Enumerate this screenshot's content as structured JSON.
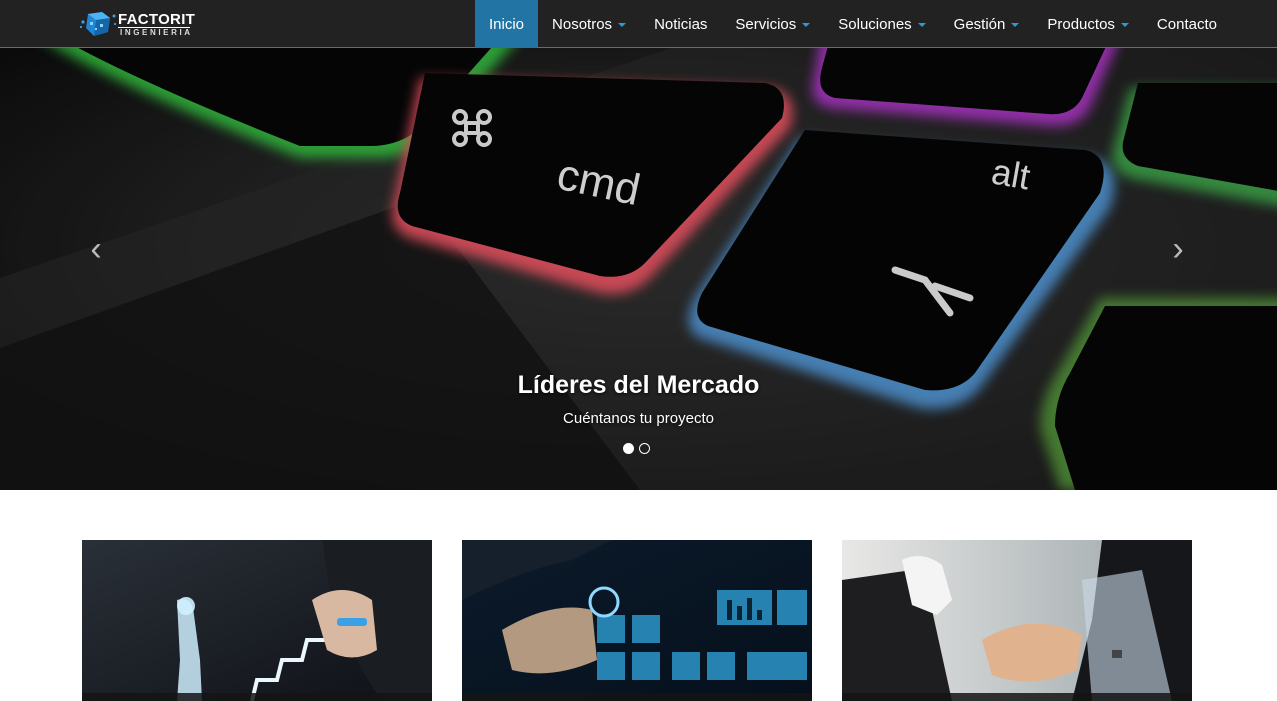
{
  "brand": {
    "name": "FACTORIT",
    "tagline": "INGENIERIA"
  },
  "nav": [
    {
      "label": "Inicio",
      "active": true,
      "dropdown": false
    },
    {
      "label": "Nosotros",
      "active": false,
      "dropdown": true
    },
    {
      "label": "Noticias",
      "active": false,
      "dropdown": false
    },
    {
      "label": "Servicios",
      "active": false,
      "dropdown": true
    },
    {
      "label": "Soluciones",
      "active": false,
      "dropdown": true
    },
    {
      "label": "Gestión",
      "active": false,
      "dropdown": true
    },
    {
      "label": "Productos",
      "active": false,
      "dropdown": true
    },
    {
      "label": "Contacto",
      "active": false,
      "dropdown": false
    }
  ],
  "hero": {
    "title": "Líderes del Mercado",
    "subtitle": "Cuéntanos tu proyecto",
    "keys": {
      "cmd": "cmd",
      "alt": "alt"
    },
    "slides": 2,
    "active_slide": 1,
    "prev_icon": "chevron-left-icon",
    "next_icon": "chevron-right-icon"
  },
  "cards": [
    {
      "image": "stairs-growth-photo"
    },
    {
      "image": "technology-interface-photo"
    },
    {
      "image": "handshake-photo"
    }
  ],
  "colors": {
    "navbar": "#222222",
    "accent": "#2274a5",
    "caret": "#2a9ad8"
  }
}
